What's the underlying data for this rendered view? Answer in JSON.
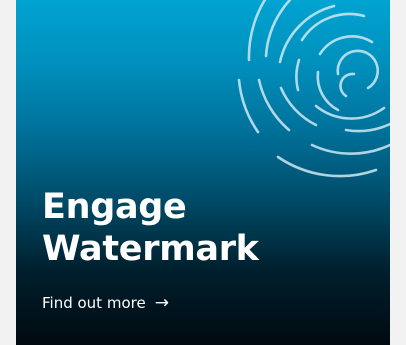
{
  "card": {
    "title_line1": "Engage",
    "title_line2": "Watermark",
    "cta_label": "Find out more",
    "cta_icon": "arrow-right-icon",
    "arrow_glyph": "→",
    "background_top": "#00a3d1",
    "background_bottom": "#000a10"
  }
}
